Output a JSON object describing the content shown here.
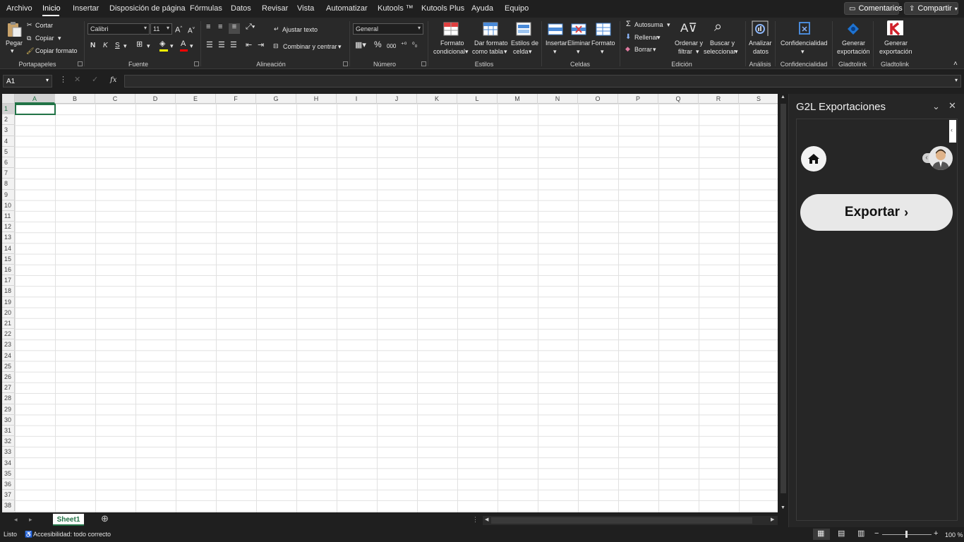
{
  "menu": {
    "tabs": [
      "Archivo",
      "Inicio",
      "Insertar",
      "Disposición de página",
      "Fórmulas",
      "Datos",
      "Revisar",
      "Vista",
      "Automatizar",
      "Kutools ™",
      "Kutools Plus",
      "Ayuda",
      "Equipo"
    ],
    "active_tab": "Inicio",
    "comments_label": "Comentarios",
    "share_label": "Compartir"
  },
  "ribbon": {
    "clipboard": {
      "paste": "Pegar",
      "cut": "Cortar",
      "copy": "Copiar",
      "format_painter": "Copiar formato",
      "group": "Portapapeles"
    },
    "font": {
      "name": "Calibri",
      "size": "11",
      "bold": "N",
      "italic": "K",
      "underline": "S",
      "group": "Fuente"
    },
    "alignment": {
      "wrap": "Ajustar texto",
      "merge": "Combinar y centrar",
      "group": "Alineación"
    },
    "number": {
      "format": "General",
      "percent": "%",
      "thousands": "000",
      "group": "Número"
    },
    "styles": {
      "conditional_1": "Formato",
      "conditional_2": "condicional",
      "table_1": "Dar formato",
      "table_2": "como tabla",
      "cell_1": "Estilos de",
      "cell_2": "celda",
      "group": "Estilos"
    },
    "cells": {
      "insert": "Insertar",
      "delete": "Eliminar",
      "format": "Formato",
      "group": "Celdas"
    },
    "editing": {
      "autosum": "Autosuma",
      "fill": "Rellenar",
      "clear": "Borrar",
      "sort_1": "Ordenar y",
      "sort_2": "filtrar",
      "find_1": "Buscar y",
      "find_2": "seleccionar",
      "group": "Edición"
    },
    "analysis": {
      "analyze_1": "Analizar",
      "analyze_2": "datos",
      "group": "Análisis"
    },
    "confidential": {
      "label": "Confidencialidad",
      "group": "Confidencialidad"
    },
    "gladtolink1": {
      "label_1": "Generar",
      "label_2": "exportación",
      "group": "Gladtolink"
    },
    "gladtolink2": {
      "label_1": "Generar",
      "label_2": "exportación",
      "group": "Gladtolink"
    }
  },
  "formula_bar": {
    "name_box": "A1",
    "fx": "fx",
    "value": ""
  },
  "columns": [
    "A",
    "B",
    "C",
    "D",
    "E",
    "F",
    "G",
    "H",
    "I",
    "J",
    "K",
    "L",
    "M",
    "N",
    "O",
    "P",
    "Q",
    "R",
    "S"
  ],
  "rows": [
    "1",
    "2",
    "3",
    "4",
    "5",
    "6",
    "7",
    "8",
    "9",
    "10",
    "11",
    "12",
    "13",
    "14",
    "15",
    "16",
    "17",
    "18",
    "19",
    "20",
    "21",
    "22",
    "23",
    "24",
    "25",
    "26",
    "27",
    "28",
    "29",
    "30",
    "31",
    "32",
    "33",
    "34",
    "35",
    "36",
    "37",
    "38"
  ],
  "selected_cell": "A1",
  "sheets": [
    "Sheet1"
  ],
  "status": {
    "ready": "Listo",
    "accessibility": "Accesibilidad: todo correcto",
    "zoom": "100 %",
    "minus": "−",
    "plus": "+"
  },
  "taskpane": {
    "title": "G2L Exportaciones",
    "export_label": "Exportar"
  },
  "colors": {
    "excel_green": "#217346",
    "background": "#1f1f1f",
    "ribbon": "#292929"
  }
}
